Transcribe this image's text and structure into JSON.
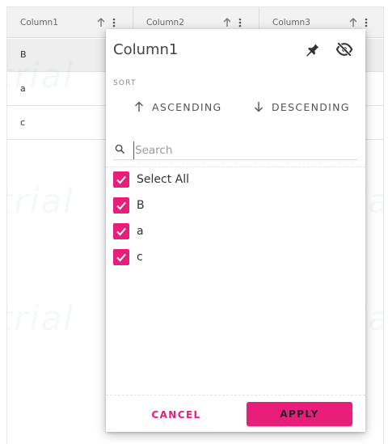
{
  "grid": {
    "columns": [
      {
        "label": "Column1"
      },
      {
        "label": "Column2"
      },
      {
        "label": "Column3"
      }
    ],
    "rows": [
      {
        "value": "B"
      },
      {
        "value": "a"
      },
      {
        "value": "c"
      }
    ],
    "watermark": "trial"
  },
  "popup": {
    "title": "Column1",
    "sort_label": "SORT",
    "ascending_label": "ASCENDING",
    "descending_label": "DESCENDING",
    "search_placeholder": "Search",
    "items": [
      {
        "label": "Select All",
        "checked": true
      },
      {
        "label": "B",
        "checked": true
      },
      {
        "label": "a",
        "checked": true
      },
      {
        "label": "c",
        "checked": true
      }
    ],
    "cancel_label": "CANCEL",
    "apply_label": "APPLY"
  },
  "colors": {
    "accent": "#e91e7b",
    "focus": "#1f5fd6"
  },
  "icons": [
    "arrow-up-icon",
    "kebab-menu-icon",
    "pin-icon",
    "eye-off-icon",
    "arrow-down-icon",
    "search-icon",
    "checkmark-icon"
  ]
}
